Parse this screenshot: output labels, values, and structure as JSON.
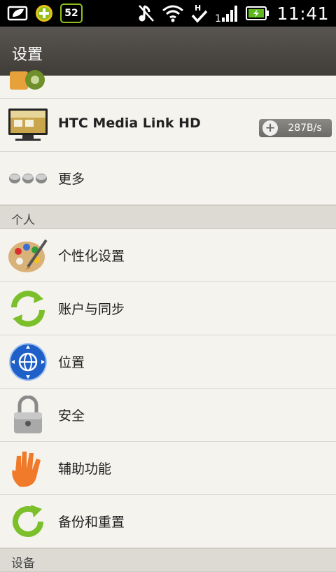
{
  "status_bar": {
    "notification_count": "52",
    "time": "11:41"
  },
  "header": {
    "title": "设置"
  },
  "items_top": [
    {
      "label": "HTC Media Link HD",
      "badge": "287B/s"
    },
    {
      "label": "更多"
    }
  ],
  "section_personal": {
    "label": "个人"
  },
  "items_personal": [
    {
      "label": "个性化设置"
    },
    {
      "label": "账户与同步"
    },
    {
      "label": "位置"
    },
    {
      "label": "安全"
    },
    {
      "label": "辅助功能"
    },
    {
      "label": "备份和重置"
    }
  ],
  "section_device": {
    "label": "设备"
  },
  "colors": {
    "accent_green": "#7bbf2a",
    "header": "#4a4743"
  }
}
